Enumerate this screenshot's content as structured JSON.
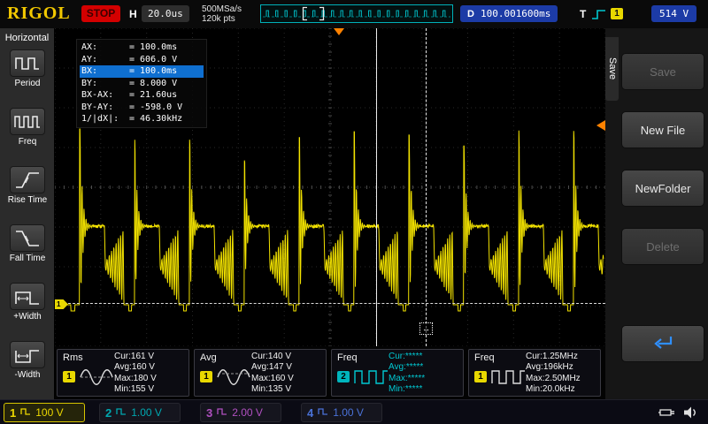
{
  "top_bar": {
    "logo": "RIGOL",
    "run_state": "STOP",
    "horizontal": {
      "label": "H",
      "timebase": "20.0us"
    },
    "acquisition": {
      "sample_rate": "500MSa/s",
      "memory_depth": "120k pts"
    },
    "delay": {
      "label": "D",
      "value": "100.001600ms"
    },
    "trigger": {
      "label": "T",
      "channel": "1",
      "level": "514 V"
    }
  },
  "left_menu": {
    "title": "Horizontal",
    "items": [
      {
        "label": "Period"
      },
      {
        "label": "Freq"
      },
      {
        "label": "Rise Time"
      },
      {
        "label": "Fall Time"
      },
      {
        "label": "+Width"
      },
      {
        "label": "-Width"
      }
    ]
  },
  "cursor_panel": {
    "rows": [
      {
        "label": "AX:",
        "value": "= 100.0ms",
        "highlight": false
      },
      {
        "label": "AY:",
        "value": "= 606.0 V",
        "highlight": false
      },
      {
        "label": "BX:",
        "value": "= 100.0ms",
        "highlight": true
      },
      {
        "label": "BY:",
        "value": "= 8.000 V",
        "highlight": false
      },
      {
        "label": "BX-AX:",
        "value": "= 21.60us",
        "highlight": false
      },
      {
        "label": "BY-AY:",
        "value": "= -598.0 V",
        "highlight": false
      },
      {
        "label": "1/|dX|:",
        "value": "= 46.30kHz",
        "highlight": false
      }
    ]
  },
  "save_menu": {
    "tab": "Save",
    "buttons": [
      {
        "label": "Save",
        "disabled": true
      },
      {
        "label": "New File",
        "disabled": false
      },
      {
        "label": "NewFolder",
        "disabled": false
      },
      {
        "label": "Delete",
        "disabled": true
      }
    ],
    "back_button": {
      "icon": "return-arrow-icon"
    }
  },
  "measurements": [
    {
      "name": "Rms",
      "channel": "1",
      "rows": [
        "Cur:161 V",
        "Avg:160 V",
        "Max:180 V",
        "Min:155 V"
      ]
    },
    {
      "name": "Avg",
      "channel": "1",
      "rows": [
        "Cur:140 V",
        "Avg:147 V",
        "Max:160 V",
        "Min:135 V"
      ]
    },
    {
      "name": "Freq",
      "channel": "2",
      "rows": [
        "Cur:*****",
        "Avg:*****",
        "Max:*****",
        "Min:*****"
      ]
    },
    {
      "name": "Freq",
      "channel": "1",
      "rows": [
        "Cur:1.25MHz",
        "Avg:196kHz",
        "Max:2.50MHz",
        "Min:20.0kHz"
      ]
    }
  ],
  "channels": [
    {
      "id": "1",
      "scale": "100 V",
      "active": true,
      "color": "#ecd800"
    },
    {
      "id": "2",
      "scale": "1.00 V",
      "active": false,
      "color": "#00a8b0"
    },
    {
      "id": "3",
      "scale": "2.00 V",
      "active": false,
      "color": "#b050c0"
    },
    {
      "id": "4",
      "scale": "1.00 V",
      "active": false,
      "color": "#4a72d8"
    }
  ],
  "colors": {
    "waveform": "#f2e200",
    "accent_orange": "#ff8200",
    "cursor_highlight": "#0f6fd0",
    "preview_border": "#00b0b8"
  }
}
